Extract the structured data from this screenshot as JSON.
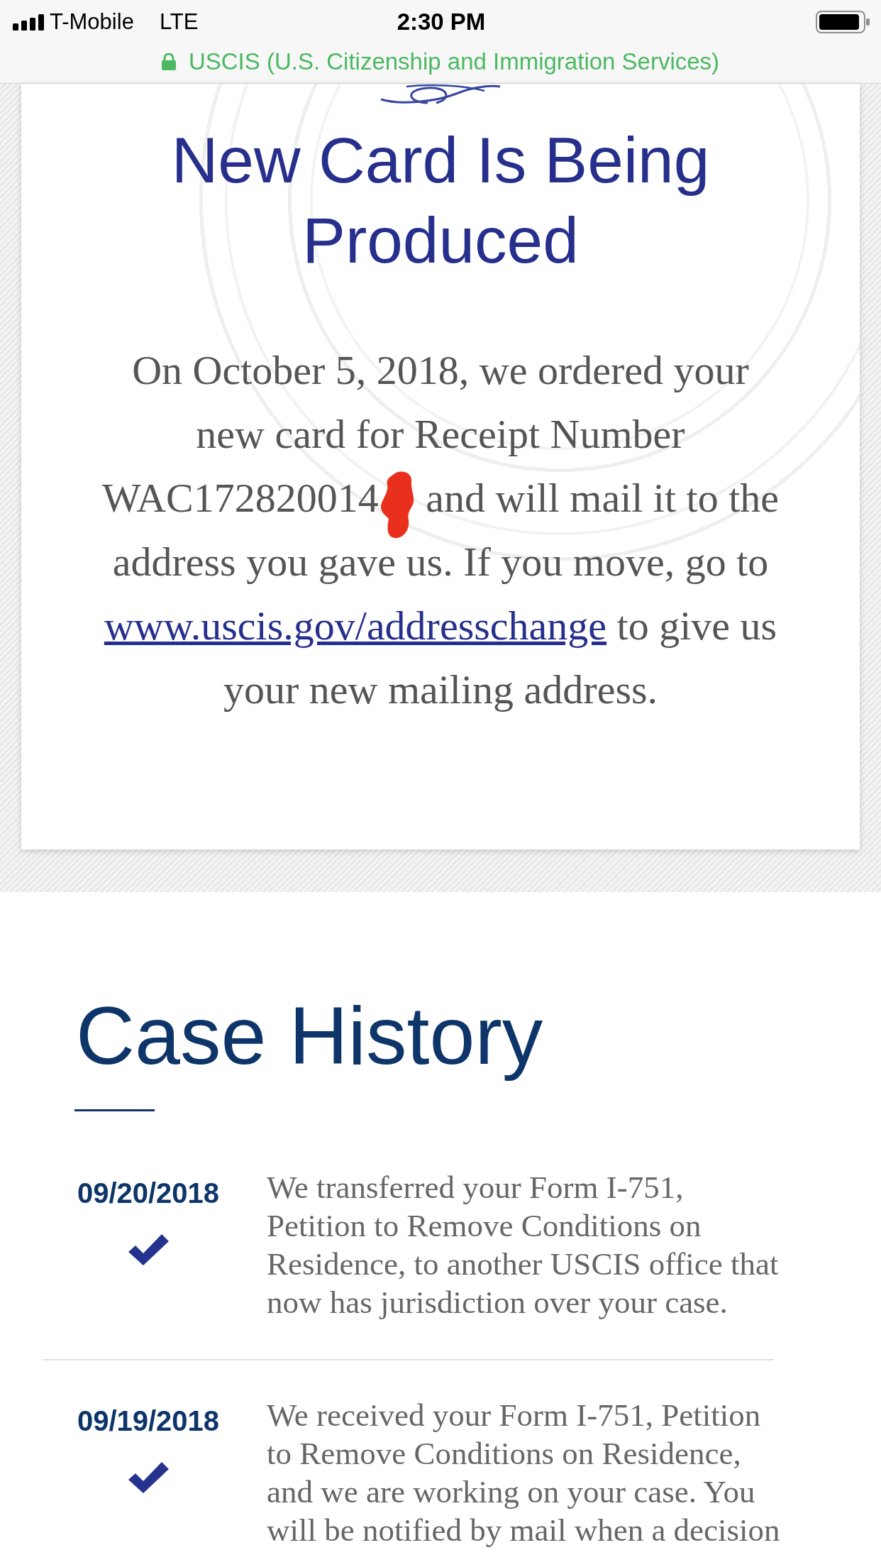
{
  "status_bar": {
    "carrier": "T-Mobile",
    "network": "LTE",
    "time": "2:30 PM"
  },
  "address_bar": {
    "site_name": "USCIS (U.S. Citizenship and Immigration Services)",
    "secure": true
  },
  "status_card": {
    "title": "New Card Is Being Produced",
    "message": {
      "before_redaction": "On October 5, 2018, we ordered your new card for Receipt Number WAC172820014",
      "after_redaction": "and will mail it to the address you gave us. If you move, go to",
      "link": "www.uscis.gov/addresschange",
      "after_link": "to give us your new mailing address."
    }
  },
  "case_history": {
    "heading": "Case History",
    "entries": [
      {
        "date": "09/20/2018",
        "done": true,
        "text": "We transferred your Form I-751, Petition to Remove Conditions on Residence, to another USCIS office that now has jurisdiction over your case."
      },
      {
        "date": "09/19/2018",
        "done": true,
        "text": "We received your Form I-751, Petition to Remove Conditions on Residence, and we are working on your case. You will be notified by mail when a decision"
      }
    ]
  }
}
